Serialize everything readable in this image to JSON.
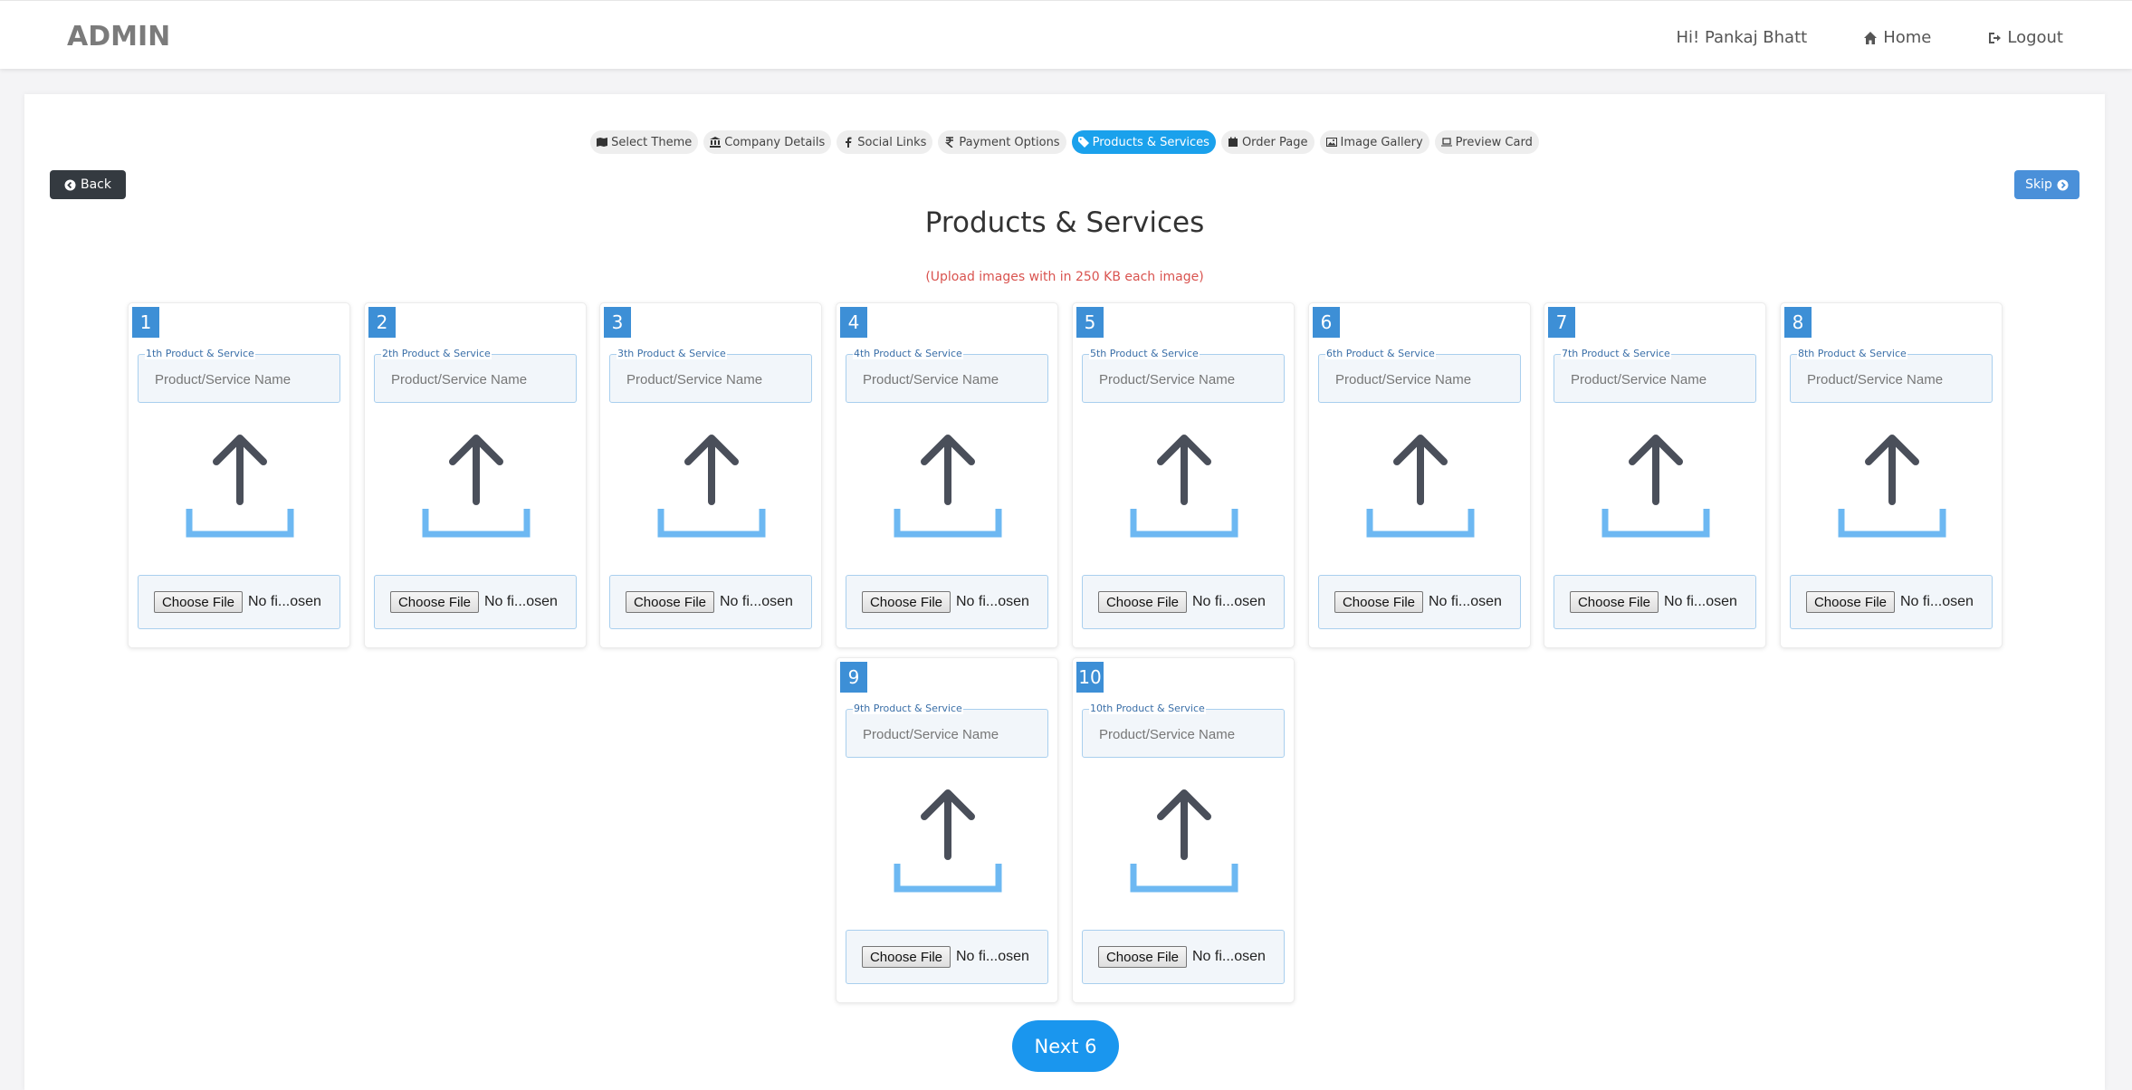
{
  "header": {
    "brand": "ADMIN",
    "greeting": "Hi! Pankaj Bhatt",
    "home_label": "Home",
    "logout_label": "Logout"
  },
  "steps": [
    {
      "label": "Select Theme",
      "icon": "map-icon",
      "active": false
    },
    {
      "label": "Company Details",
      "icon": "bank-icon",
      "active": false
    },
    {
      "label": "Social Links",
      "icon": "facebook-icon",
      "active": false
    },
    {
      "label": "Payment Options",
      "icon": "rupee-icon",
      "active": false
    },
    {
      "label": "Products & Services",
      "icon": "tag-icon",
      "active": true
    },
    {
      "label": "Order Page",
      "icon": "calendar-icon",
      "active": false
    },
    {
      "label": "Image Gallery",
      "icon": "image-icon",
      "active": false
    },
    {
      "label": "Preview Card",
      "icon": "laptop-icon",
      "active": false
    }
  ],
  "back_label": "Back",
  "skip_label": "Skip",
  "page_title": "Products & Services",
  "upload_note": "(Upload images with in 250 KB each image)",
  "products": [
    {
      "number": "1",
      "legend": "1th Product & Service",
      "placeholder": "Product/Service Name",
      "choose_label": "Choose File",
      "file_status": "No fi...osen"
    },
    {
      "number": "2",
      "legend": "2th Product & Service",
      "placeholder": "Product/Service Name",
      "choose_label": "Choose File",
      "file_status": "No fi...osen"
    },
    {
      "number": "3",
      "legend": "3th Product & Service",
      "placeholder": "Product/Service Name",
      "choose_label": "Choose File",
      "file_status": "No fi...osen"
    },
    {
      "number": "4",
      "legend": "4th Product & Service",
      "placeholder": "Product/Service Name",
      "choose_label": "Choose File",
      "file_status": "No fi...osen"
    },
    {
      "number": "5",
      "legend": "5th Product & Service",
      "placeholder": "Product/Service Name",
      "choose_label": "Choose File",
      "file_status": "No fi...osen"
    },
    {
      "number": "6",
      "legend": "6th Product & Service",
      "placeholder": "Product/Service Name",
      "choose_label": "Choose File",
      "file_status": "No fi...osen"
    },
    {
      "number": "7",
      "legend": "7th Product & Service",
      "placeholder": "Product/Service Name",
      "choose_label": "Choose File",
      "file_status": "No fi...osen"
    },
    {
      "number": "8",
      "legend": "8th Product & Service",
      "placeholder": "Product/Service Name",
      "choose_label": "Choose File",
      "file_status": "No fi...osen"
    },
    {
      "number": "9",
      "legend": "9th Product & Service",
      "placeholder": "Product/Service Name",
      "choose_label": "Choose File",
      "file_status": "No fi...osen"
    },
    {
      "number": "10",
      "legend": "10th Product & Service",
      "placeholder": "Product/Service Name",
      "choose_label": "Choose File",
      "file_status": "No fi...osen"
    }
  ],
  "next_label": "Next 6",
  "colors": {
    "active_tab": "#1aa1ec",
    "number_badge": "#3d8fd6",
    "upload_arrow": "#4a4f5a",
    "upload_tray": "#6db8f2",
    "note": "#d9534f",
    "next_button": "#1a96ee"
  }
}
